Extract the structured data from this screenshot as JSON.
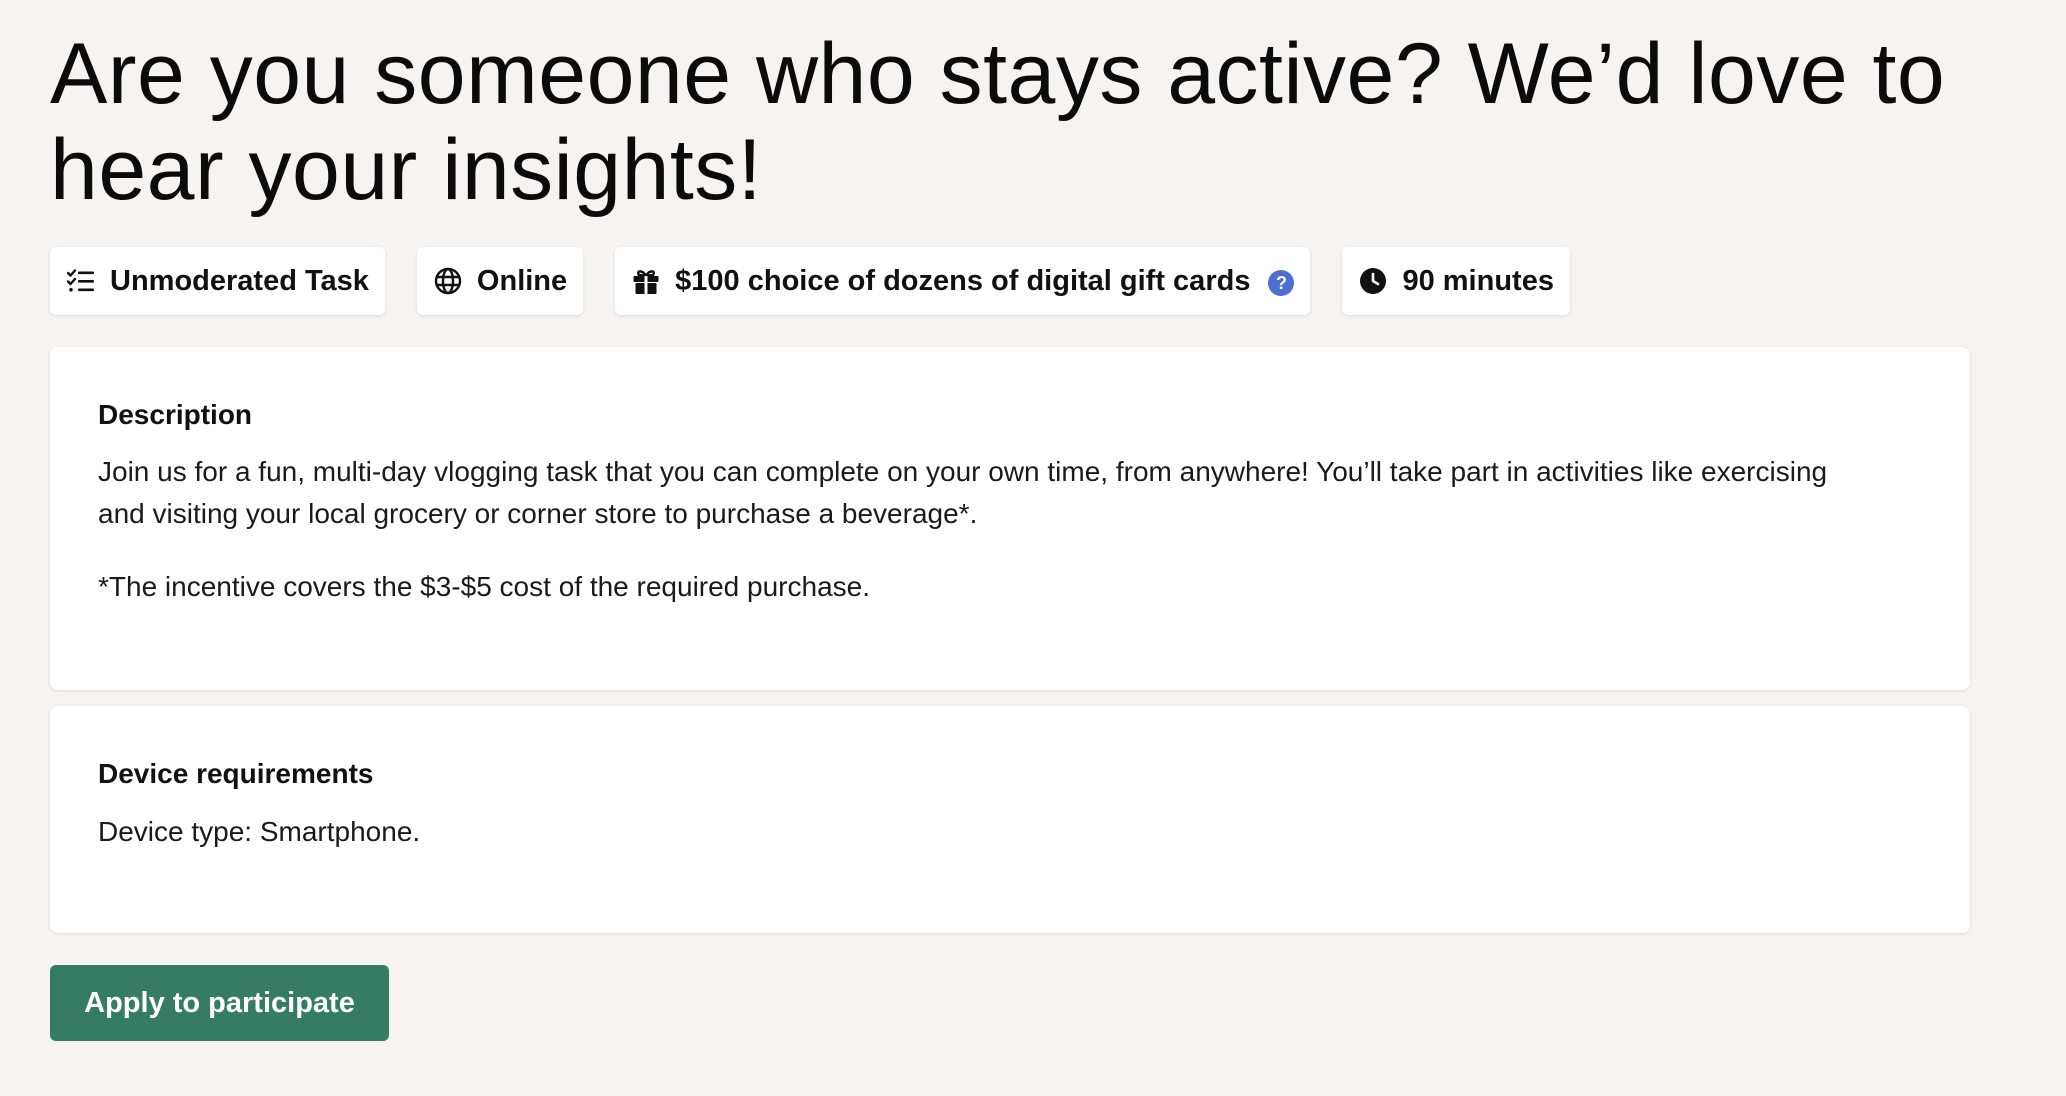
{
  "header": {
    "title": "Are you someone who stays active? We’d love to hear your insights!"
  },
  "chips": {
    "task_type": {
      "label": "Unmoderated Task",
      "icon": "task-list-icon"
    },
    "location": {
      "label": "Online",
      "icon": "globe-icon"
    },
    "incentive": {
      "label": "$100 choice of dozens of digital gift cards",
      "icon": "gift-icon",
      "help_icon": "help-icon",
      "help_symbol": "?"
    },
    "duration": {
      "label": "90 minutes",
      "icon": "clock-icon"
    }
  },
  "description": {
    "heading": "Description",
    "paragraph1": "Join us for a fun, multi-day vlogging task that you can complete on your own time, from anywhere! You’ll take part in activities like exercising and visiting your local grocery or corner store to purchase a beverage*.",
    "paragraph2": "*The incentive covers the $3-$5 cost of the required purchase."
  },
  "device_requirements": {
    "heading": "Device requirements",
    "text": "Device type: Smartphone."
  },
  "actions": {
    "apply_label": "Apply to participate"
  },
  "colors": {
    "background": "#f6f3f0",
    "button": "#367c64",
    "help_badge": "#4f6fd0"
  }
}
